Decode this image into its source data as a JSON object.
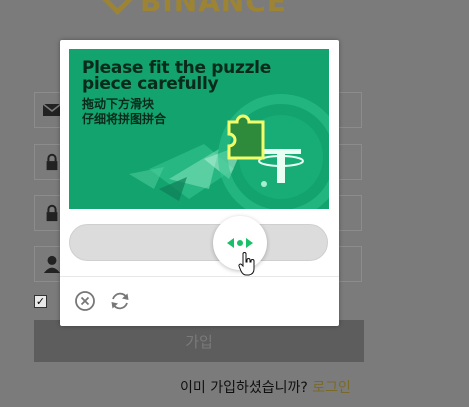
{
  "background_page": {
    "brand": "BINANCE",
    "fields": [
      {
        "icon": "envelope-icon"
      },
      {
        "icon": "lock-icon"
      },
      {
        "icon": "lock-icon"
      },
      {
        "icon": "user-icon"
      }
    ],
    "agree_checked": true,
    "submit_label": "가입",
    "login_prompt": "이미 가입하셨습니까?",
    "login_link": "로그인"
  },
  "captcha": {
    "title_en": "Please fit the puzzle piece carefully",
    "title_cn_line1": "拖动下方滑块",
    "title_cn_line2": "仔细将拼图拼合",
    "slider_progress": 0.56,
    "actions": [
      {
        "icon": "close-circle-icon"
      },
      {
        "icon": "refresh-icon"
      }
    ],
    "colors": {
      "puzzle_bg": "#12a36f",
      "puzzle_piece": "#d7e63a",
      "slider_arrows": "#1bbf6a"
    }
  }
}
